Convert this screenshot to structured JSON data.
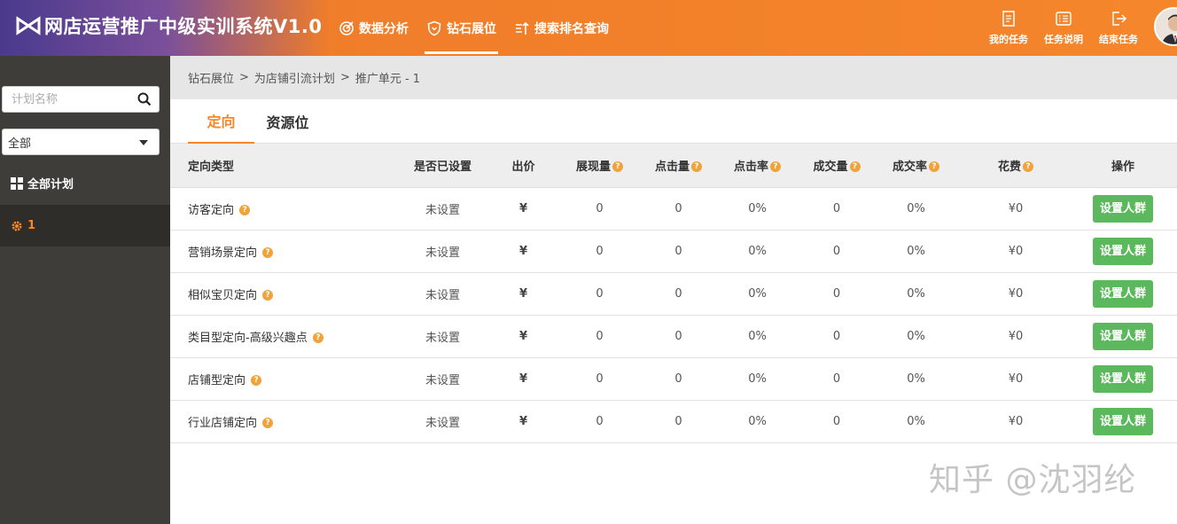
{
  "header": {
    "app_title": "网店运营推广中级实训系统V1.0",
    "nav": [
      {
        "label": "数据分析",
        "icon": "target-icon"
      },
      {
        "label": "钻石展位",
        "icon": "shield-icon"
      },
      {
        "label": "搜索排名查询",
        "icon": "sort-icon"
      }
    ],
    "active_nav": "钻石展位",
    "tools": [
      {
        "label": "我的任务",
        "icon": "document-icon"
      },
      {
        "label": "任务说明",
        "icon": "checklist-icon"
      },
      {
        "label": "结束任务",
        "icon": "exit-icon"
      }
    ]
  },
  "sidebar": {
    "search_placeholder": "计划名称",
    "select_value": "全部",
    "all_plans_label": "全部计划",
    "plan_label": "1"
  },
  "breadcrumb": [
    "钻石展位",
    "为店铺引流计划",
    "推广单元 - 1"
  ],
  "breadcrumb_sep": ">",
  "tabs": [
    "定向",
    "资源位"
  ],
  "table": {
    "columns": [
      "定向类型",
      "是否已设置",
      "出价",
      "展现量",
      "点击量",
      "点击率",
      "成交量",
      "成交率",
      "花费",
      "操作"
    ],
    "rows": [
      {
        "type": "访客定向",
        "set": "未设置",
        "bid": "¥",
        "impressions": "0",
        "clicks": "0",
        "ctr": "0%",
        "deals": "0",
        "cvr": "0%",
        "cost": "¥0",
        "action": "设置人群"
      },
      {
        "type": "营销场景定向",
        "set": "未设置",
        "bid": "¥",
        "impressions": "0",
        "clicks": "0",
        "ctr": "0%",
        "deals": "0",
        "cvr": "0%",
        "cost": "¥0",
        "action": "设置人群"
      },
      {
        "type": "相似宝贝定向",
        "set": "未设置",
        "bid": "¥",
        "impressions": "0",
        "clicks": "0",
        "ctr": "0%",
        "deals": "0",
        "cvr": "0%",
        "cost": "¥0",
        "action": "设置人群"
      },
      {
        "type": "类目型定向-高级兴趣点",
        "set": "未设置",
        "bid": "¥",
        "impressions": "0",
        "clicks": "0",
        "ctr": "0%",
        "deals": "0",
        "cvr": "0%",
        "cost": "¥0",
        "action": "设置人群"
      },
      {
        "type": "店铺型定向",
        "set": "未设置",
        "bid": "¥",
        "impressions": "0",
        "clicks": "0",
        "ctr": "0%",
        "deals": "0",
        "cvr": "0%",
        "cost": "¥0",
        "action": "设置人群"
      },
      {
        "type": "行业店铺定向",
        "set": "未设置",
        "bid": "¥",
        "impressions": "0",
        "clicks": "0",
        "ctr": "0%",
        "deals": "0",
        "cvr": "0%",
        "cost": "¥0",
        "action": "设置人群"
      }
    ]
  },
  "watermark": "知乎 @沈羽纶",
  "colors": {
    "accent": "#f5862b",
    "button_green": "#5cb85c",
    "sidebar_bg": "#3f3d3a",
    "help_icon": "#f0a33a"
  }
}
